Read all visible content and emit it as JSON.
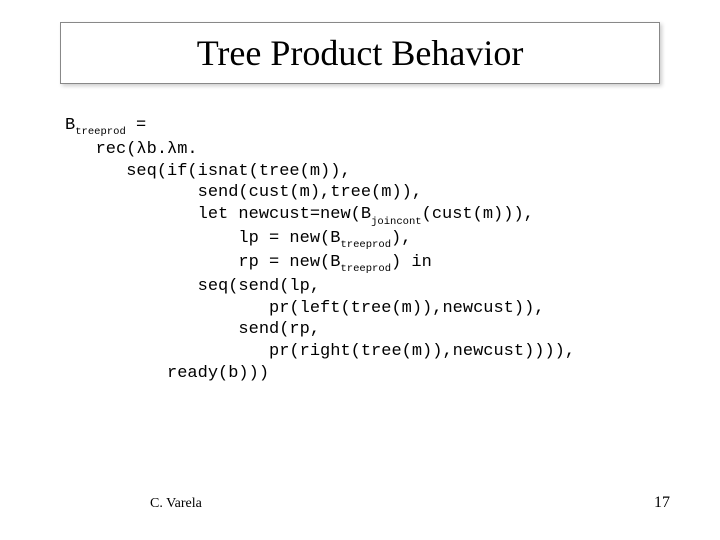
{
  "title": "Tree Product Behavior",
  "code": {
    "l1_pre": "B",
    "l1_sub": "treeprod",
    "l1_post": " =",
    "l2": "   rec(λb.λm.",
    "l3": "      seq(if(isnat(tree(m)),",
    "l4": "             send(cust(m),tree(m)),",
    "l5_pre": "             let newcust=new(B",
    "l5_sub": "joincont",
    "l5_post": "(cust(m))),",
    "l6_pre": "                 lp = new(B",
    "l6_sub": "treeprod",
    "l6_post": "),",
    "l7_pre": "                 rp = new(B",
    "l7_sub": "treeprod",
    "l7_post": ") in",
    "l8": "             seq(send(lp,",
    "l9": "                    pr(left(tree(m)),newcust)),",
    "l10": "                 send(rp,",
    "l11": "                    pr(right(tree(m)),newcust)))),",
    "l12": "          ready(b)))"
  },
  "author": "C. Varela",
  "page": "17"
}
